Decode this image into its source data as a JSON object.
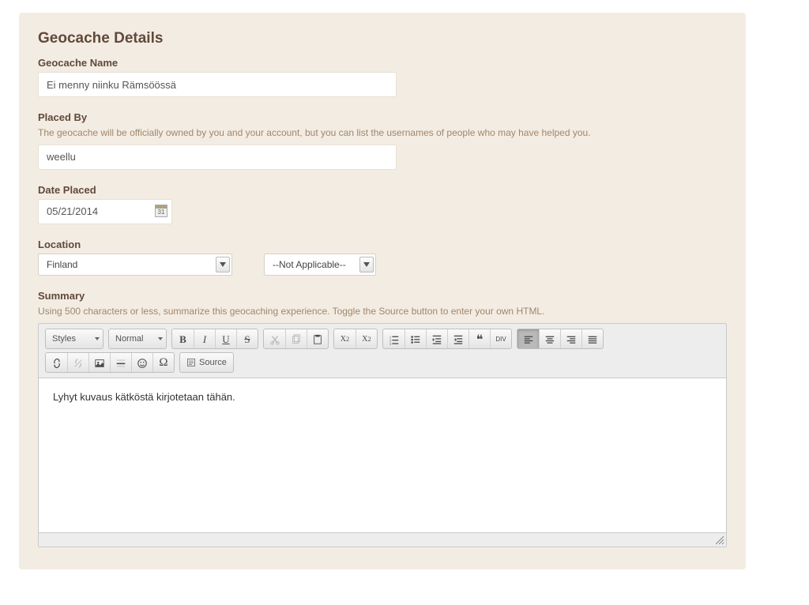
{
  "title": "Geocache Details",
  "fields": {
    "name": {
      "label": "Geocache Name",
      "value": "Ei menny niinku Rämsöössä"
    },
    "placed_by": {
      "label": "Placed By",
      "help": "The geocache will be officially owned by you and your account, but you can list the usernames of people who may have helped you.",
      "value": "weellu"
    },
    "date_placed": {
      "label": "Date Placed",
      "value": "05/21/2014",
      "calendar_day": "31"
    },
    "location": {
      "label": "Location",
      "country": "Finland",
      "region": "--Not Applicable--"
    },
    "summary": {
      "label": "Summary",
      "help": "Using 500 characters or less, summarize this geocaching experience. Toggle the Source button to enter your own HTML.",
      "content": "Lyhyt kuvaus kätköstä kirjotetaan tähän."
    }
  },
  "editor": {
    "styles_dd": "Styles",
    "format_dd": "Normal",
    "source_btn": "Source"
  }
}
